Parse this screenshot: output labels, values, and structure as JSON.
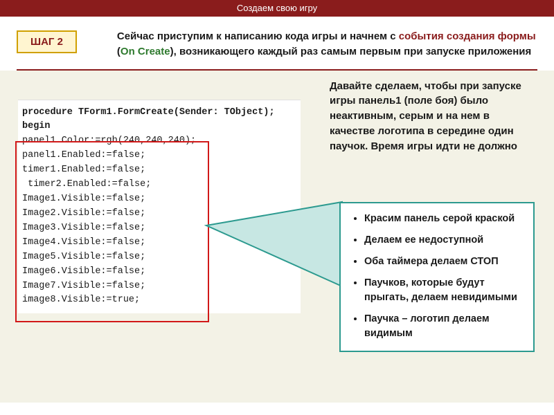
{
  "header": {
    "title": "Создаем свою игру"
  },
  "step": {
    "label": "ШАГ 2"
  },
  "intro": {
    "part1_dark": "Сейчас приступим к написанию кода игры и начнем с ",
    "part2_red": "события создания формы",
    "part3_dark": " (",
    "part4_green": "On Create",
    "part5_dark": "), возникающего каждый раз самым первым при запуске приложения"
  },
  "code": {
    "lines": [
      "",
      "procedure TForm1.FormCreate(Sender: TObject);",
      "begin",
      "",
      "panel1.Color:=rgb(240,240,240);",
      "panel1.Enabled:=false;",
      "timer1.Enabled:=false;",
      " timer2.Enabled:=false;",
      "Image1.Visible:=false;",
      "Image2.Visible:=false;",
      "Image3.Visible:=false;",
      "Image4.Visible:=false;",
      "Image5.Visible:=false;",
      "Image6.Visible:=false;",
      "Image7.Visible:=false;",
      "image8.Visible:=true;"
    ]
  },
  "explain": {
    "text": "Давайте сделаем, чтобы при запуске игры панель1 (поле боя) было неактивным, серым и на нем в качестве логотипа в середине один паучок. Время игры идти не должно"
  },
  "callout": {
    "items": [
      "Красим панель серой краской",
      "Делаем ее недоступной",
      "Оба таймера делаем СТОП",
      "Паучков, которые будут прыгать, делаем невидимыми",
      "Паучка – логотип делаем видимым"
    ]
  }
}
